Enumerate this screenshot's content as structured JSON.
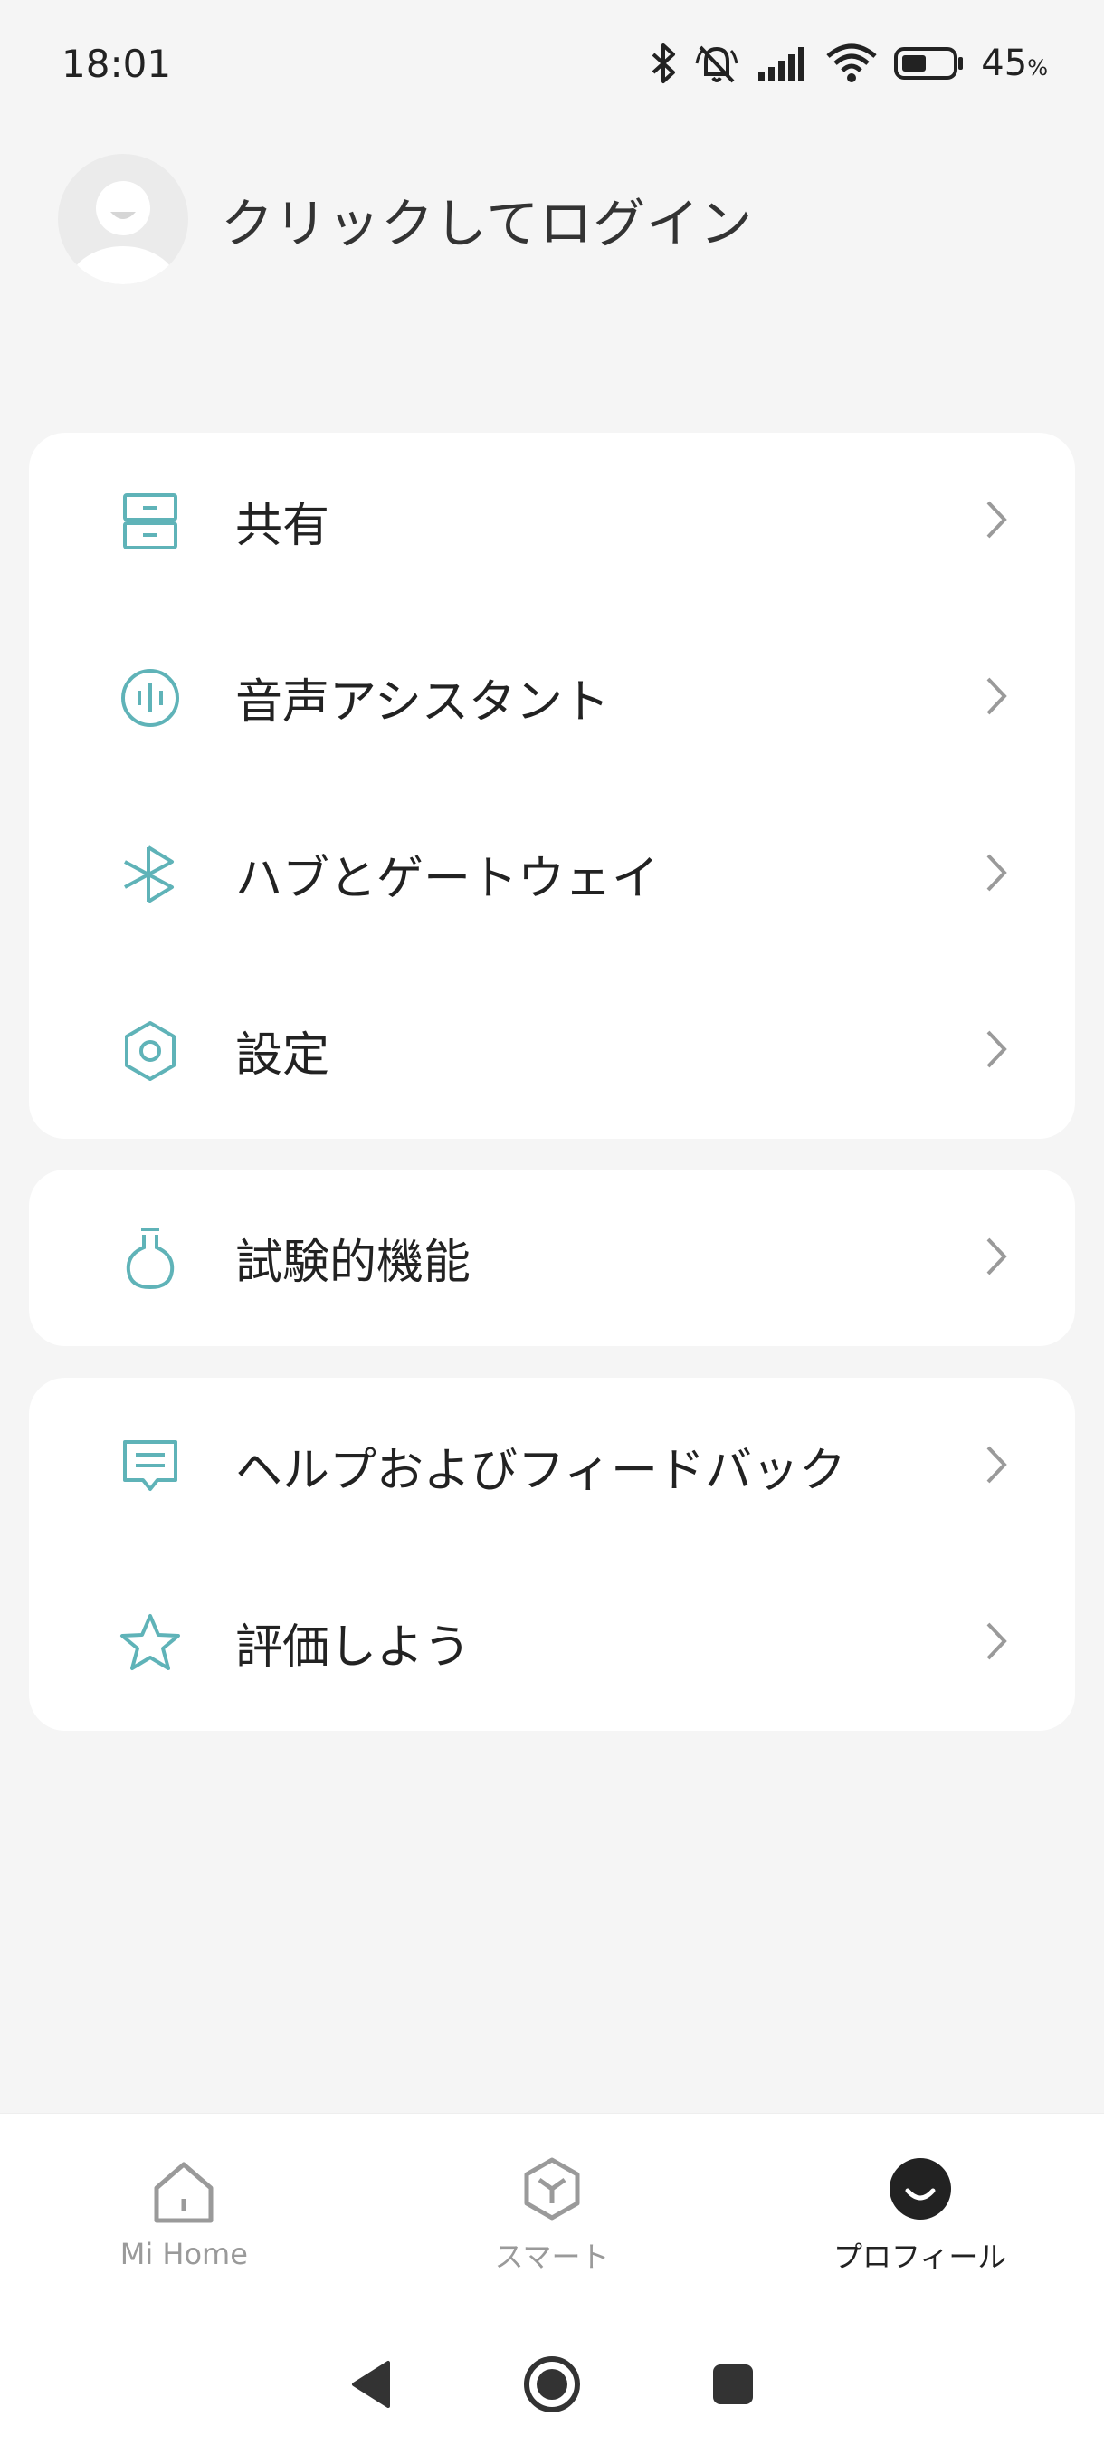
{
  "status_bar": {
    "time": "18:01",
    "battery_percent": "45",
    "battery_unit": "%",
    "icons": [
      "bluetooth-icon",
      "mute-bell-icon",
      "signal-icon",
      "wifi-icon",
      "battery-icon"
    ]
  },
  "profile": {
    "login_prompt": "クリックしてログイン",
    "avatar_icon": "default-avatar-icon"
  },
  "menu_groups": [
    {
      "items": [
        {
          "label": "共有",
          "icon": "share-icon"
        },
        {
          "label": "音声アシスタント",
          "icon": "voice-assistant-icon"
        },
        {
          "label": "ハブとゲートウェイ",
          "icon": "bluetooth-hub-icon"
        },
        {
          "label": "設定",
          "icon": "settings-hex-icon"
        }
      ]
    },
    {
      "items": [
        {
          "label": "試験的機能",
          "icon": "flask-icon"
        }
      ]
    },
    {
      "items": [
        {
          "label": "ヘルプおよびフィードバック",
          "icon": "feedback-icon"
        },
        {
          "label": "評価しよう",
          "icon": "star-icon"
        }
      ]
    }
  ],
  "bottom_nav": {
    "items": [
      {
        "label": "Mi Home",
        "icon": "home-icon",
        "active": false
      },
      {
        "label": "スマート",
        "icon": "smart-cube-icon",
        "active": false
      },
      {
        "label": "プロフィール",
        "icon": "profile-icon",
        "active": true
      }
    ]
  },
  "colors": {
    "accent": "#5fb3b8",
    "background": "#f5f5f5",
    "card": "#ffffff",
    "text": "#222222",
    "inactive": "#9a9a9a"
  }
}
